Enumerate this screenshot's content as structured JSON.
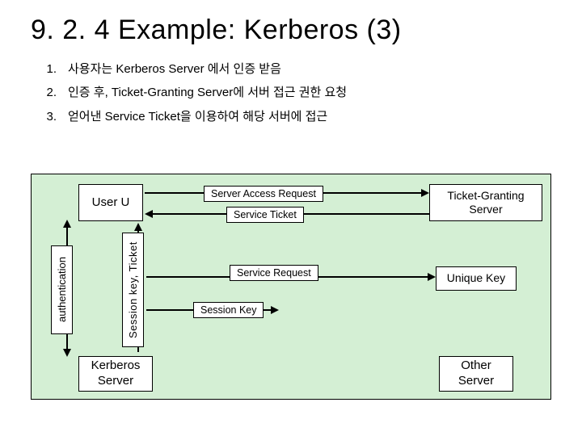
{
  "title": "9. 2. 4 Example: Kerberos (3)",
  "list": [
    {
      "num": "1.",
      "text": "사용자는 Kerberos Server 에서 인증 받음"
    },
    {
      "num": "2.",
      "text": "인증 후, Ticket-Granting Server에 서버 접근 권한 요청"
    },
    {
      "num": "3.",
      "text": "얻어낸 Service Ticket을 이용하여 해당 서버에 접근"
    }
  ],
  "boxes": {
    "user": "User\nU",
    "tgs": "Ticket-Granting\nServer",
    "kerberos": "Kerberos\nServer",
    "other": "Other\nServer",
    "unique": "Unique Key"
  },
  "messages": {
    "server_access_request": "Server Access Request",
    "service_ticket": "Service Ticket",
    "service_request": "Service Request",
    "session_key": "Session Key"
  },
  "vertical": {
    "authentication": "authentication",
    "session_key_ticket": "Session key, Ticket"
  }
}
